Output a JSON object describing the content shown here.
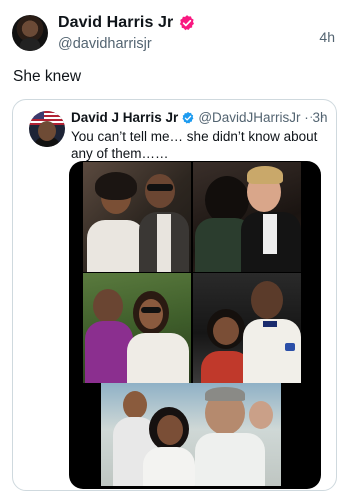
{
  "author": {
    "display_name": "David Harris Jr",
    "handle": "@davidharrisjr",
    "timestamp": "4h",
    "verified_icon": "verified-badge-icon",
    "verified_color": "#f91880"
  },
  "post": {
    "text": "She knew"
  },
  "quoted_post": {
    "display_name": "David J Harris Jr",
    "handle_and_time": "@DavidJHarrisJr · 3h",
    "more_label": "···",
    "text": "You can’t tell me… she didn’t know about any of them……",
    "verified_color": "#1d9bf0",
    "media": {
      "photos": [
        {
          "label": "photo-1"
        },
        {
          "label": "photo-2"
        },
        {
          "label": "photo-3"
        },
        {
          "label": "photo-4"
        },
        {
          "label": "photo-5"
        }
      ]
    }
  }
}
